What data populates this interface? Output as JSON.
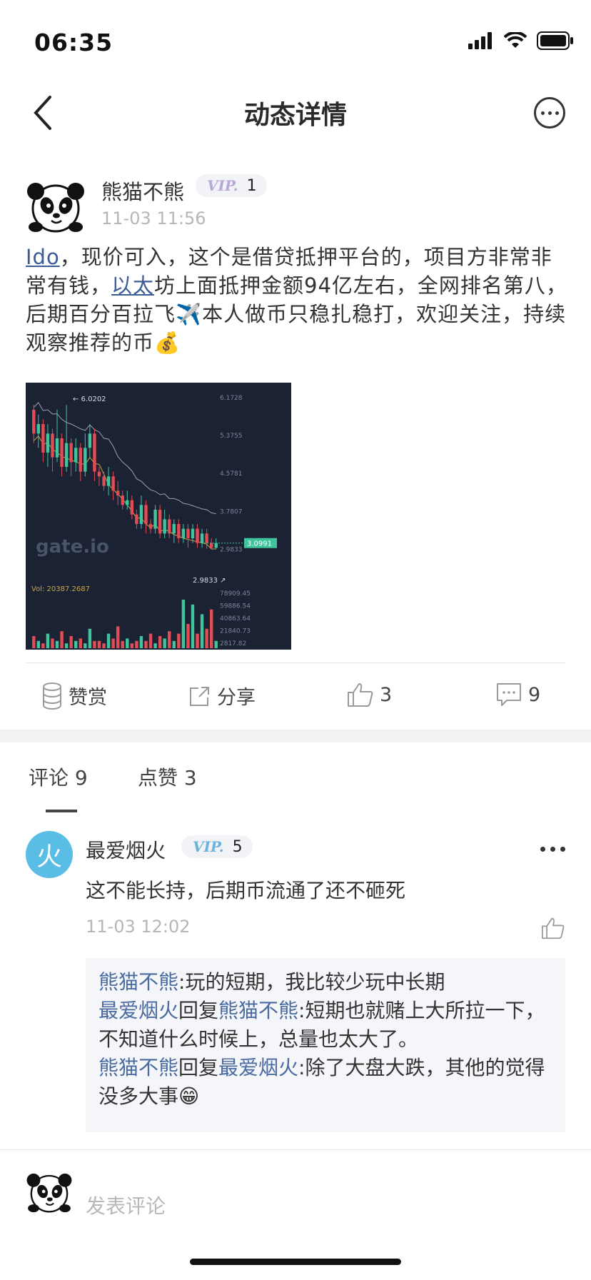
{
  "status_bar": {
    "time": "06:35"
  },
  "nav": {
    "title": "动态详情"
  },
  "post": {
    "author": "熊猫不熊",
    "vip_label": "VIP.",
    "vip_level": "1",
    "time": "11-03 11:56",
    "text_segments": [
      {
        "text": "Ido",
        "link": true
      },
      {
        "text": "，现价可入，这个是借贷抵押平台的，项目方非常非常有钱，",
        "link": false
      },
      {
        "text": "以太",
        "link": true
      },
      {
        "text": "坊上面抵押金额94亿左右，全网排名第八，后期百分百拉飞✈️本人做币只稳扎稳打，欢迎关注，持续观察推荐的币💰",
        "link": false
      }
    ]
  },
  "chart_data": {
    "type": "candlestick",
    "watermark": "gate.io",
    "high_label": "6.0202",
    "low_label": "2.9833",
    "current_price": "3.0991",
    "vol_label": "Vol: 20387.2687",
    "price_ticks": [
      "6.1728",
      "5.3755",
      "4.5781",
      "3.7807",
      "2.9833"
    ],
    "volume_ticks": [
      "78909.45",
      "59886.54",
      "40863.64",
      "21840.73",
      "2817.82"
    ],
    "ylim": [
      2.9,
      6.2
    ],
    "candles": [
      [
        5.9,
        5.4,
        6.0,
        5.2
      ],
      [
        5.4,
        5.6,
        5.8,
        5.1
      ],
      [
        5.6,
        5.0,
        5.7,
        4.8
      ],
      [
        5.0,
        5.4,
        5.6,
        4.7
      ],
      [
        5.4,
        4.9,
        5.5,
        4.6
      ],
      [
        4.9,
        5.3,
        5.9,
        4.8
      ],
      [
        5.3,
        4.7,
        5.4,
        4.5
      ],
      [
        4.7,
        5.2,
        6.0,
        4.6
      ],
      [
        5.2,
        4.8,
        5.3,
        4.5
      ],
      [
        4.8,
        5.1,
        5.3,
        4.6
      ],
      [
        5.1,
        4.6,
        5.2,
        4.4
      ],
      [
        4.6,
        5.1,
        5.4,
        4.5
      ],
      [
        5.1,
        5.4,
        5.6,
        4.9
      ],
      [
        5.4,
        4.6,
        5.5,
        4.4
      ],
      [
        4.6,
        4.5,
        4.7,
        4.3
      ],
      [
        4.5,
        4.3,
        4.6,
        4.2
      ],
      [
        4.3,
        4.5,
        4.7,
        4.1
      ],
      [
        4.5,
        4.2,
        4.6,
        4.0
      ],
      [
        4.2,
        4.1,
        4.4,
        3.9
      ],
      [
        4.1,
        3.9,
        4.2,
        3.8
      ],
      [
        3.9,
        4.0,
        4.2,
        3.8
      ],
      [
        4.0,
        3.7,
        4.1,
        3.6
      ],
      [
        3.7,
        3.5,
        3.8,
        3.4
      ],
      [
        3.5,
        3.9,
        4.1,
        3.4
      ],
      [
        3.9,
        3.5,
        4.0,
        3.3
      ],
      [
        3.5,
        3.4,
        3.6,
        3.3
      ],
      [
        3.4,
        3.8,
        3.9,
        3.3
      ],
      [
        3.8,
        3.3,
        3.9,
        3.2
      ],
      [
        3.3,
        3.6,
        3.8,
        3.2
      ],
      [
        3.6,
        3.3,
        3.7,
        3.2
      ],
      [
        3.3,
        3.5,
        3.6,
        3.1
      ],
      [
        3.5,
        3.2,
        3.6,
        3.1
      ],
      [
        3.2,
        3.4,
        3.5,
        3.1
      ],
      [
        3.4,
        3.2,
        3.5,
        3.0
      ],
      [
        3.2,
        3.4,
        3.5,
        3.1
      ],
      [
        3.4,
        3.1,
        3.5,
        3.0
      ],
      [
        3.1,
        3.3,
        3.4,
        3.0
      ],
      [
        3.3,
        3.1,
        3.4,
        2.98
      ],
      [
        3.1,
        3.0,
        3.2,
        2.98
      ],
      [
        3.0,
        3.1,
        3.2,
        2.98
      ]
    ],
    "volumes": [
      5,
      3,
      2,
      6,
      4,
      3,
      7,
      2,
      5,
      3,
      4,
      2,
      8,
      3,
      3,
      2,
      6,
      4,
      9,
      3,
      4,
      2,
      3,
      5,
      3,
      6,
      2,
      5,
      4,
      7,
      3,
      6,
      20,
      10,
      18,
      6,
      14,
      8,
      16,
      3
    ]
  },
  "actions": {
    "reward": "赞赏",
    "share": "分享",
    "likes": "3",
    "comments": "9"
  },
  "tabs": {
    "comments": "评论 9",
    "likes": "点赞 3"
  },
  "comment": {
    "avatar_char": "火",
    "author": "最爱烟火",
    "vip_label": "VIP.",
    "vip_level": "5",
    "text": "这不能长持，后期币流通了还不砸死",
    "time": "11-03 12:02"
  },
  "replies": [
    {
      "from": "熊猫不熊",
      "to": "",
      "text": ":玩的短期，我比较少玩中长期"
    },
    {
      "from": "最爱烟火",
      "to": "熊猫不熊",
      "text": ":短期也就赌上大所拉一下，不知道什么时候上，总量也太大了。"
    },
    {
      "from": "熊猫不熊",
      "to": "最爱烟火",
      "text": ":除了大盘大跌，其他的觉得没多大事😁"
    }
  ],
  "reply_word": "回复",
  "compose": {
    "placeholder": "发表评论"
  },
  "colors": {
    "link": "#3b5c99",
    "name": "#4a6aa0",
    "up": "#3fc49b",
    "down": "#e24c55",
    "chart_bg": "#1a2233"
  }
}
